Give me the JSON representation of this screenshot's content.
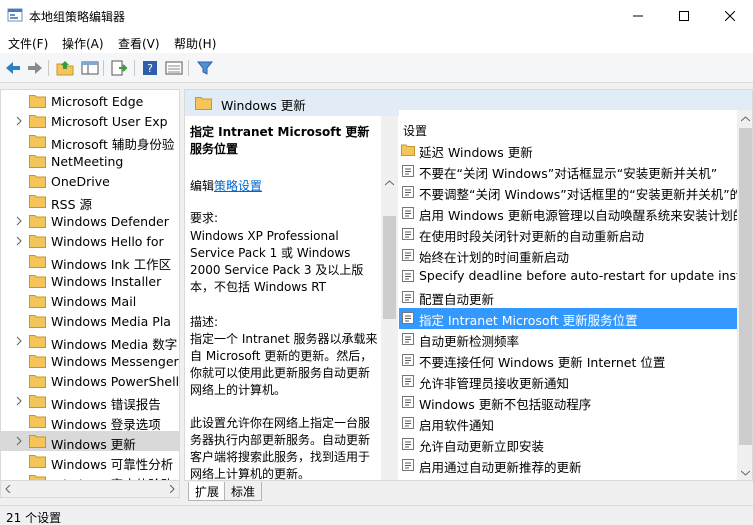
{
  "window": {
    "title": "本地组策略编辑器",
    "minimize_icon": "minimize-icon",
    "maximize_icon": "maximize-icon",
    "close_icon": "close-icon"
  },
  "menu": [
    "文件(F)",
    "操作(A)",
    "查看(V)",
    "帮助(H)"
  ],
  "toolbar": {
    "icons": [
      "back-icon",
      "forward-icon",
      "up-folder-icon",
      "show-hide-tree-icon",
      "export-list-icon",
      "help-icon",
      "view-icon",
      "filter-icon"
    ]
  },
  "tree": {
    "items": [
      {
        "label": "Microsoft Edge",
        "expandable": false
      },
      {
        "label": "Microsoft User Exp",
        "expandable": true
      },
      {
        "label": "Microsoft 辅助身份验",
        "expandable": false
      },
      {
        "label": "NetMeeting",
        "expandable": false
      },
      {
        "label": "OneDrive",
        "expandable": false
      },
      {
        "label": "RSS 源",
        "expandable": false
      },
      {
        "label": "Windows Defender",
        "expandable": true
      },
      {
        "label": "Windows Hello for",
        "expandable": true
      },
      {
        "label": "Windows Ink 工作区",
        "expandable": false
      },
      {
        "label": "Windows Installer",
        "expandable": false
      },
      {
        "label": "Windows Mail",
        "expandable": false
      },
      {
        "label": "Windows Media Pla",
        "expandable": false
      },
      {
        "label": "Windows Media 数字",
        "expandable": true
      },
      {
        "label": "Windows Messenger",
        "expandable": false
      },
      {
        "label": "Windows PowerShell",
        "expandable": false
      },
      {
        "label": "Windows 错误报告",
        "expandable": true
      },
      {
        "label": "Windows 登录选项",
        "expandable": false
      },
      {
        "label": "Windows 更新",
        "expandable": true,
        "selected": true
      },
      {
        "label": "Windows 可靠性分析",
        "expandable": false
      },
      {
        "label": "Windows 客户体验改",
        "expandable": false
      }
    ]
  },
  "right_pane": {
    "header_title": "Windows 更新"
  },
  "description": {
    "title": "指定 Intranet Microsoft 更新服务位置",
    "edit_prefix": "编辑",
    "edit_link": "策略设置",
    "requirements_heading": "要求:",
    "requirements_text": "Windows XP Professional Service Pack 1 或 Windows 2000 Service Pack 3 及以上版本，不包括 Windows RT",
    "description_heading": "描述:",
    "description_text": "指定一个 Intranet 服务器以承载来自 Microsoft 更新的更新。然后，你就可以使用此更新服务自动更新网络上的计算机。",
    "detail_text": "此设置允许你在网络上指定一台服务器执行内部更新服务。自动更新客户端将搜索此服务，找到适用于网络上计算机的更新。"
  },
  "settings_list": {
    "header": "设置",
    "items": [
      {
        "label": "延迟 Windows 更新",
        "type": "folder"
      },
      {
        "label": "不要在“关闭 Windows”对话框显示“安装更新并关机”",
        "type": "setting"
      },
      {
        "label": "不要调整“关闭 Windows”对话框里的“安装更新并关机”的默认",
        "type": "setting"
      },
      {
        "label": "启用 Windows 更新电源管理以自动唤醒系统来安装计划的更新",
        "type": "setting"
      },
      {
        "label": "在使用时段关闭针对更新的自动重新启动",
        "type": "setting"
      },
      {
        "label": "始终在计划的时间重新启动",
        "type": "setting"
      },
      {
        "label": "Specify deadline before auto-restart for update insta",
        "type": "setting"
      },
      {
        "label": "配置自动更新",
        "type": "setting"
      },
      {
        "label": "指定 Intranet Microsoft 更新服务位置",
        "type": "setting",
        "selected": true
      },
      {
        "label": "自动更新检测频率",
        "type": "setting"
      },
      {
        "label": "不要连接任何 Windows 更新 Internet 位置",
        "type": "setting"
      },
      {
        "label": "允许非管理员接收更新通知",
        "type": "setting"
      },
      {
        "label": "Windows 更新不包括驱动程序",
        "type": "setting"
      },
      {
        "label": "启用软件通知",
        "type": "setting"
      },
      {
        "label": "允许自动更新立即安装",
        "type": "setting"
      },
      {
        "label": "启用通过自动更新推荐的更新",
        "type": "setting"
      }
    ]
  },
  "tabs": [
    "扩展",
    "标准"
  ],
  "status": "21 个设置",
  "colors": {
    "selection": "#3399ff",
    "header_bg": "#e1ecf7",
    "link": "#0066cc",
    "folder": "#f4c55a"
  }
}
